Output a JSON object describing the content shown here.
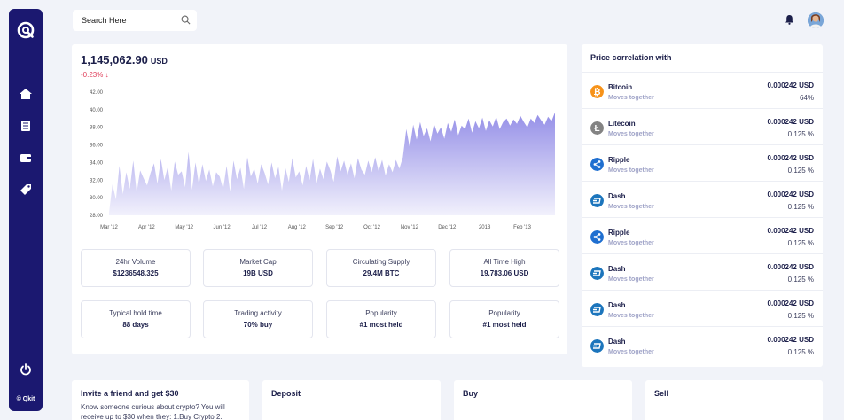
{
  "sidebar": {
    "brand": "© Qkit",
    "items": [
      {
        "icon": "home-icon"
      },
      {
        "icon": "list-icon"
      },
      {
        "icon": "wallet-icon"
      },
      {
        "icon": "tag-icon"
      }
    ]
  },
  "header": {
    "search_placeholder": "Search Here"
  },
  "price": {
    "value": "1,145,062.90",
    "unit": "USD",
    "change": "-0.23%",
    "change_arrow": "↓",
    "change_color": "#e0405c"
  },
  "chart_data": {
    "type": "area",
    "x_ticks": [
      "Mar '12",
      "Apr '12",
      "May '12",
      "Jun '12",
      "Jul '12",
      "Aug '12",
      "Sep '12",
      "Oct '12",
      "Nov '12",
      "Dec '12",
      "2013",
      "Feb '13"
    ],
    "y_ticks": [
      "42.00",
      "40.00",
      "38.00",
      "36.00",
      "34.00",
      "32.00",
      "30.00",
      "28.00"
    ],
    "ylim": [
      28,
      42
    ],
    "color": "#8f89e6",
    "values": [
      28.3,
      31.5,
      29.8,
      33.6,
      30.4,
      32.9,
      31.0,
      34.2,
      30.6,
      33.1,
      32.2,
      31.4,
      32.8,
      33.9,
      31.6,
      34.4,
      32.0,
      33.5,
      30.8,
      34.1,
      32.6,
      33.0,
      31.2,
      35.2,
      30.9,
      34.0,
      31.5,
      33.8,
      31.9,
      33.2,
      31.3,
      32.9,
      32.4,
      31.0,
      33.6,
      30.7,
      34.2,
      32.1,
      33.4,
      31.0,
      34.6,
      32.4,
      33.3,
      31.6,
      33.8,
      32.8,
      31.5,
      34.0,
      32.2,
      33.5,
      30.8,
      33.4,
      31.8,
      34.5,
      32.3,
      33.0,
      31.4,
      33.6,
      32.0,
      34.4,
      31.6,
      33.3,
      32.1,
      34.1,
      33.1,
      31.8,
      34.7,
      33.0,
      34.2,
      32.6,
      33.9,
      32.2,
      34.5,
      33.2,
      32.6,
      34.2,
      32.9,
      34.6,
      33.0,
      34.3,
      32.5,
      33.8,
      32.9,
      34.3,
      33.3,
      34.6,
      37.8,
      35.7,
      38.3,
      36.6,
      38.6,
      37.0,
      37.9,
      36.4,
      38.4,
      37.3,
      38.0,
      36.7,
      38.5,
      37.5,
      38.9,
      37.1,
      38.2,
      37.8,
      39.0,
      37.4,
      38.7,
      37.9,
      39.1,
      37.6,
      38.8,
      38.1,
      39.2,
      37.8,
      38.6,
      39.0,
      38.2,
      38.9,
      38.4,
      39.3,
      38.6,
      38.0,
      39.0,
      38.5,
      39.4,
      38.8,
      38.3,
      39.2,
      38.7,
      39.7
    ]
  },
  "stats": [
    {
      "label": "24hr Volume",
      "value": "$1236548.325"
    },
    {
      "label": "Market Cap",
      "value": "19B USD"
    },
    {
      "label": "Circulating Supply",
      "value": "29.4M BTC"
    },
    {
      "label": "All Time High",
      "value": "19.783.06 USD"
    },
    {
      "label": "Typical hold time",
      "value": "88 days"
    },
    {
      "label": "Trading activity",
      "value": "70% buy"
    },
    {
      "label": "Popularity",
      "value": "#1 most held"
    },
    {
      "label": "Popularity",
      "value": "#1 most held"
    }
  ],
  "correlation": {
    "title": "Price correlation with",
    "items": [
      {
        "name": "Bitcoin",
        "sub": "Moves together",
        "amount": "0.000242 USD",
        "pct": "64%",
        "icon": "bitcoin-icon",
        "color": "#f7931a"
      },
      {
        "name": "Litecoin",
        "sub": "Moves together",
        "amount": "0.000242 USD",
        "pct": "0.125 %",
        "icon": "litecoin-icon",
        "color": "#838383"
      },
      {
        "name": "Ripple",
        "sub": "Moves together",
        "amount": "0.000242 USD",
        "pct": "0.125 %",
        "icon": "ripple-icon",
        "color": "#1f6fd0"
      },
      {
        "name": "Dash",
        "sub": "Moves together",
        "amount": "0.000242 USD",
        "pct": "0.125 %",
        "icon": "dash-icon",
        "color": "#1c75bc"
      },
      {
        "name": "Ripple",
        "sub": "Moves together",
        "amount": "0.000242 USD",
        "pct": "0.125 %",
        "icon": "ripple-icon",
        "color": "#1f6fd0"
      },
      {
        "name": "Dash",
        "sub": "Moves together",
        "amount": "0.000242 USD",
        "pct": "0.125 %",
        "icon": "dash-icon",
        "color": "#1c75bc"
      },
      {
        "name": "Dash",
        "sub": "Moves together",
        "amount": "0.000242 USD",
        "pct": "0.125 %",
        "icon": "dash-icon",
        "color": "#1c75bc"
      },
      {
        "name": "Dash",
        "sub": "Moves together",
        "amount": "0.000242 USD",
        "pct": "0.125 %",
        "icon": "dash-icon",
        "color": "#1c75bc"
      }
    ]
  },
  "invite": {
    "title": "Invite a friend and get $30",
    "text": "Know someone curious about crypto? You will receive up to $30 when they: 1.Buy Crypto 2."
  },
  "panels": {
    "deposit": "Deposit",
    "buy": "Buy",
    "sell": "Sell"
  }
}
